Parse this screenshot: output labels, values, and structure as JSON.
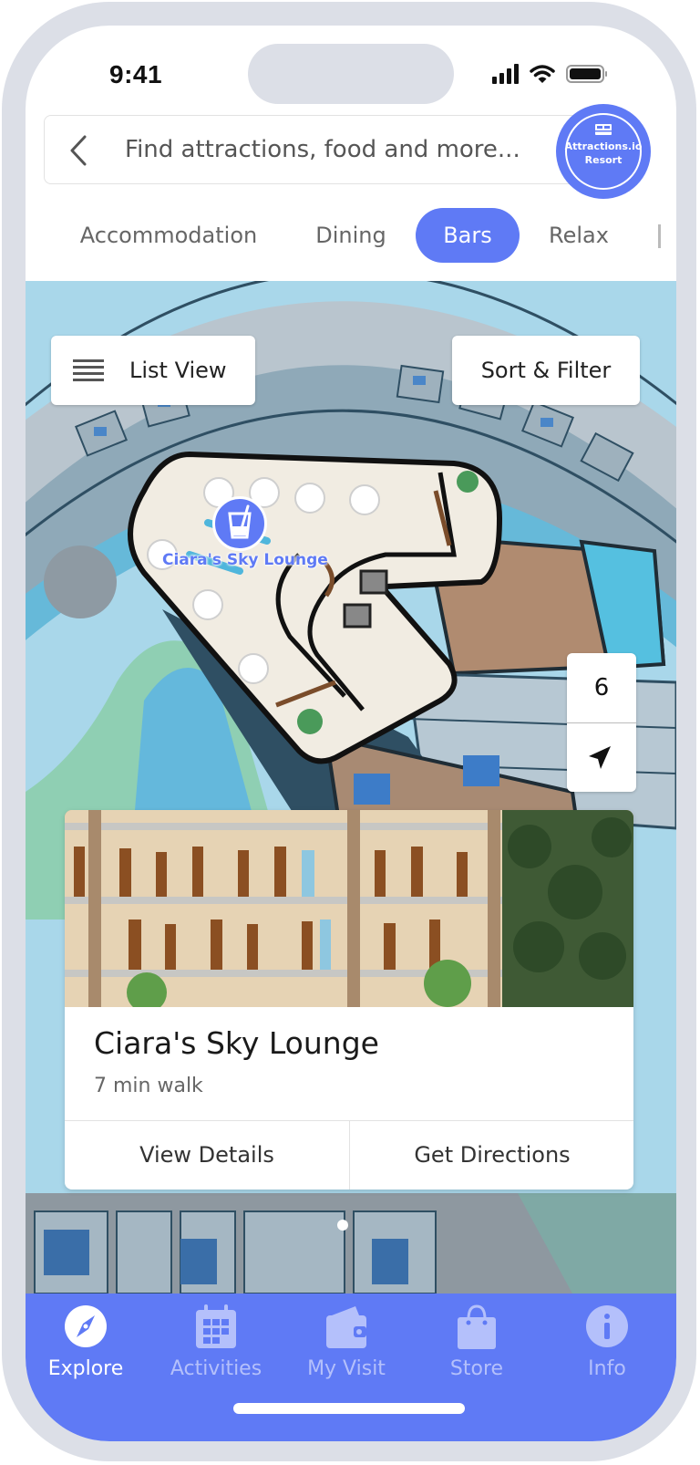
{
  "status_bar": {
    "time": "9:41"
  },
  "search": {
    "placeholder": "Find attractions, food and more...",
    "value": ""
  },
  "logo": {
    "line1": "Attractions.io",
    "line2": "Resort",
    "icon": "bed-icon"
  },
  "categories": [
    {
      "label": "Accommodation",
      "active": false
    },
    {
      "label": "Dining",
      "active": false
    },
    {
      "label": "Bars",
      "active": true
    },
    {
      "label": "Relax",
      "active": false
    }
  ],
  "map": {
    "list_view_label": "List View",
    "sort_filter_label": "Sort & Filter",
    "floor_level": "6",
    "poi": {
      "name": "Ciara's Sky Lounge",
      "icon": "drink-icon"
    }
  },
  "venue_card": {
    "name": "Ciara's Sky Lounge",
    "distance": "7 min walk",
    "view_details_label": "View Details",
    "get_directions_label": "Get Directions",
    "page_index": 1,
    "page_count": 1
  },
  "tab_bar": {
    "items": [
      {
        "label": "Explore",
        "icon": "compass-icon",
        "active": true
      },
      {
        "label": "Activities",
        "icon": "calendar-icon",
        "active": false
      },
      {
        "label": "My Visit",
        "icon": "wallet-icon",
        "active": false
      },
      {
        "label": "Store",
        "icon": "bag-icon",
        "active": false
      },
      {
        "label": "Info",
        "icon": "info-icon",
        "active": false
      }
    ]
  },
  "colors": {
    "accent": "#5f7af5",
    "tab_inactive": "#b4c0fb",
    "map_water": "#a9d7ea",
    "frame": "#dcdfe7"
  }
}
